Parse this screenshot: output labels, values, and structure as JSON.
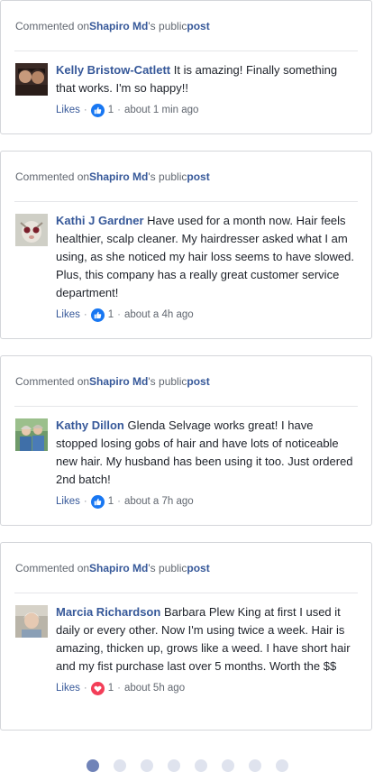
{
  "cards": [
    {
      "header": {
        "prefix": "Commented on ",
        "page": "Shapiro Md",
        "suffix": "'s public ",
        "post": "post"
      },
      "author": "Kelly Bristow-Catlett",
      "text": "It is amazing! Finally something that works. I'm so happy!!",
      "likes_label": "Likes",
      "reaction": "like",
      "count": "1",
      "time": "about 1 min ago"
    },
    {
      "header": {
        "prefix": "Commented on ",
        "page": "Shapiro Md",
        "suffix": "'s public ",
        "post": "post"
      },
      "author": "Kathi J Gardner",
      "text": "Have used for a month now. Hair feels healthier, scalp cleaner. My hairdresser asked what I am using, as she noticed my hair loss seems to have slowed. Plus, this company has a really great customer service department!",
      "likes_label": "Likes",
      "reaction": "like",
      "count": "1",
      "time": "about a 4h ago"
    },
    {
      "header": {
        "prefix": "Commented on ",
        "page": "Shapiro Md",
        "suffix": "'s public ",
        "post": "post"
      },
      "author": "Kathy Dillon",
      "text": "Glenda Selvage works great! I have stopped losing gobs of hair and have lots of noticeable new hair. My husband has been using it too. Just ordered 2nd batch!",
      "likes_label": "Likes",
      "reaction": "like",
      "count": "1",
      "time": "about a 7h ago"
    },
    {
      "header": {
        "prefix": "Commented on ",
        "page": "Shapiro Md",
        "suffix": "'s public ",
        "post": "post"
      },
      "author": "Marcia Richardson",
      "text": "Barbara Plew King at first I used it daily or every other. Now I'm using twice a week. Hair is amazing, thicken up, grows like a weed. I have short hair and my fist purchase last over 5 months. Worth the $$",
      "likes_label": "Likes",
      "reaction": "love",
      "count": "1",
      "time": "about 5h ago"
    }
  ],
  "separator": "·",
  "pager": {
    "total": 8,
    "active": 0
  },
  "colors": {
    "link": "#365899",
    "like": "#1877f2",
    "love": "#f33e58"
  },
  "icons": {
    "like": "thumbs-up-icon",
    "love": "heart-icon"
  }
}
